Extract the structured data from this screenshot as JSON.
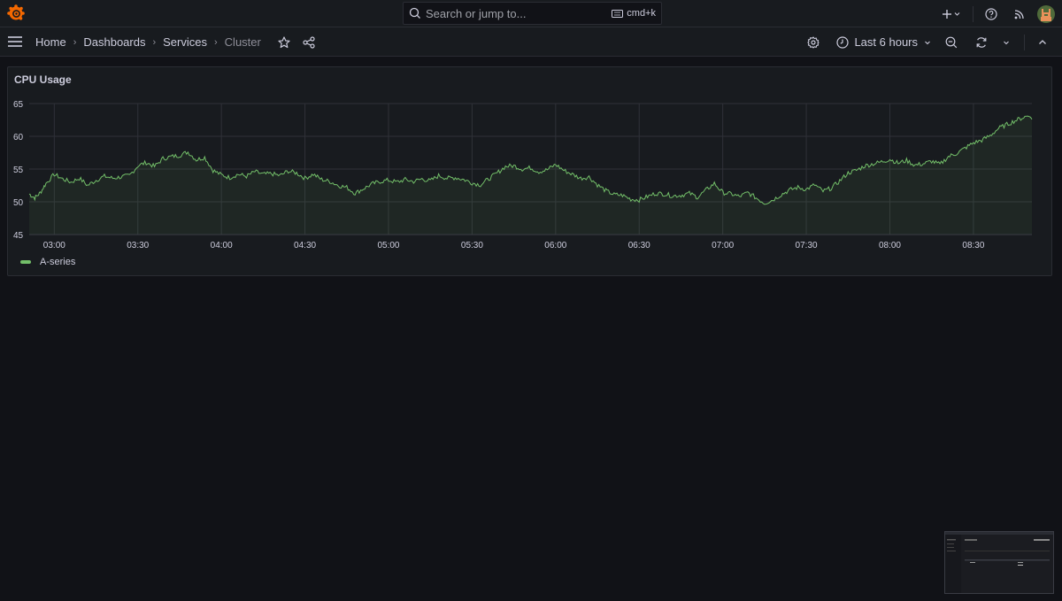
{
  "topbar": {
    "logo": "grafana-logo-icon",
    "search_placeholder": "Search or jump to...",
    "search_shortcut": "cmd+k",
    "icons": [
      "plus-icon",
      "chevron-down-icon",
      "help-icon",
      "news-rss-icon",
      "user-avatar"
    ]
  },
  "navbar": {
    "breadcrumbs": [
      "Home",
      "Dashboards",
      "Services",
      "Cluster"
    ],
    "time_range": "Last 6 hours",
    "icons": [
      "menu-icon",
      "star-icon",
      "share-icon",
      "settings-icon",
      "clock-icon",
      "zoom-out-icon",
      "refresh-icon",
      "chevron-down-icon",
      "chevron-up-icon"
    ]
  },
  "panel": {
    "title": "CPU Usage",
    "legend": "A-series"
  },
  "colors": {
    "series": "#73bf69",
    "background": "#111217",
    "panel": "#181b1f",
    "accent": "#f46800"
  },
  "chart_data": {
    "type": "line",
    "title": "CPU Usage",
    "xlabel": "",
    "ylabel": "",
    "ylim": [
      45,
      65
    ],
    "yticks": [
      "65",
      "60",
      "55",
      "50",
      "45"
    ],
    "xticks": [
      "03:00",
      "03:30",
      "04:00",
      "04:30",
      "05:00",
      "05:30",
      "06:00",
      "06:30",
      "07:00",
      "07:30",
      "08:00",
      "08:30"
    ],
    "x_range": [
      "02:51",
      "08:51"
    ],
    "grid": true,
    "fill": "area",
    "legend_position": "bottom-left",
    "series": [
      {
        "name": "A-series",
        "x_minutes_from_0300": [
          -9,
          -7,
          -5,
          -3,
          0,
          3,
          6,
          9,
          12,
          15,
          18,
          21,
          24,
          27,
          30,
          33,
          36,
          39,
          42,
          45,
          48,
          51,
          54,
          57,
          60,
          63,
          66,
          69,
          72,
          75,
          78,
          81,
          84,
          87,
          90,
          93,
          96,
          99,
          102,
          105,
          108,
          111,
          114,
          117,
          120,
          123,
          126,
          129,
          132,
          135,
          138,
          141,
          144,
          147,
          150,
          153,
          156,
          159,
          162,
          165,
          168,
          171,
          174,
          177,
          180,
          183,
          186,
          189,
          192,
          195,
          198,
          201,
          204,
          207,
          210,
          213,
          216,
          219,
          222,
          225,
          228,
          231,
          234,
          237,
          240,
          243,
          246,
          249,
          252,
          255,
          258,
          261,
          264,
          267,
          270,
          273,
          276,
          279,
          282,
          285,
          288,
          291,
          294,
          297,
          300,
          303,
          306,
          309,
          312,
          315,
          318,
          321,
          324,
          327,
          330,
          333,
          336,
          339,
          342,
          345,
          348,
          351
        ],
        "values": [
          51.2,
          50.6,
          51.4,
          52.8,
          54.2,
          53.5,
          53.0,
          53.6,
          52.5,
          53.3,
          53.9,
          53.6,
          53.8,
          54.0,
          55.5,
          56.0,
          55.4,
          56.6,
          56.9,
          57.1,
          57.6,
          56.4,
          56.8,
          54.8,
          54.1,
          53.7,
          54.2,
          53.9,
          54.6,
          54.2,
          54.3,
          54.0,
          54.7,
          54.4,
          53.6,
          54.2,
          53.4,
          53.1,
          52.5,
          52.2,
          51.3,
          52.0,
          52.7,
          53.1,
          53.3,
          53.0,
          53.4,
          53.1,
          53.5,
          53.2,
          54.0,
          53.6,
          53.7,
          53.4,
          52.9,
          52.6,
          53.5,
          54.4,
          55.4,
          55.5,
          55.0,
          55.2,
          54.6,
          54.9,
          55.7,
          54.8,
          54.2,
          53.6,
          53.8,
          52.6,
          51.7,
          51.1,
          51.0,
          50.4,
          50.3,
          50.8,
          51.3,
          51.2,
          50.9,
          51.0,
          51.3,
          50.7,
          51.8,
          52.8,
          51.4,
          51.2,
          50.8,
          51.4,
          50.6,
          49.8,
          50.3,
          51.1,
          51.8,
          52.2,
          51.9,
          52.6,
          51.6,
          52.1,
          53.2,
          54.4,
          54.8,
          55.5,
          55.8,
          56.1,
          56.5,
          55.9,
          56.3,
          55.6,
          55.8,
          56.2,
          55.7,
          56.9,
          57.4,
          58.2,
          59.0,
          59.4,
          60.1,
          61.2,
          61.8,
          62.4,
          62.9,
          63.3,
          62.9,
          62.4,
          63.8,
          62.6
        ]
      }
    ]
  }
}
